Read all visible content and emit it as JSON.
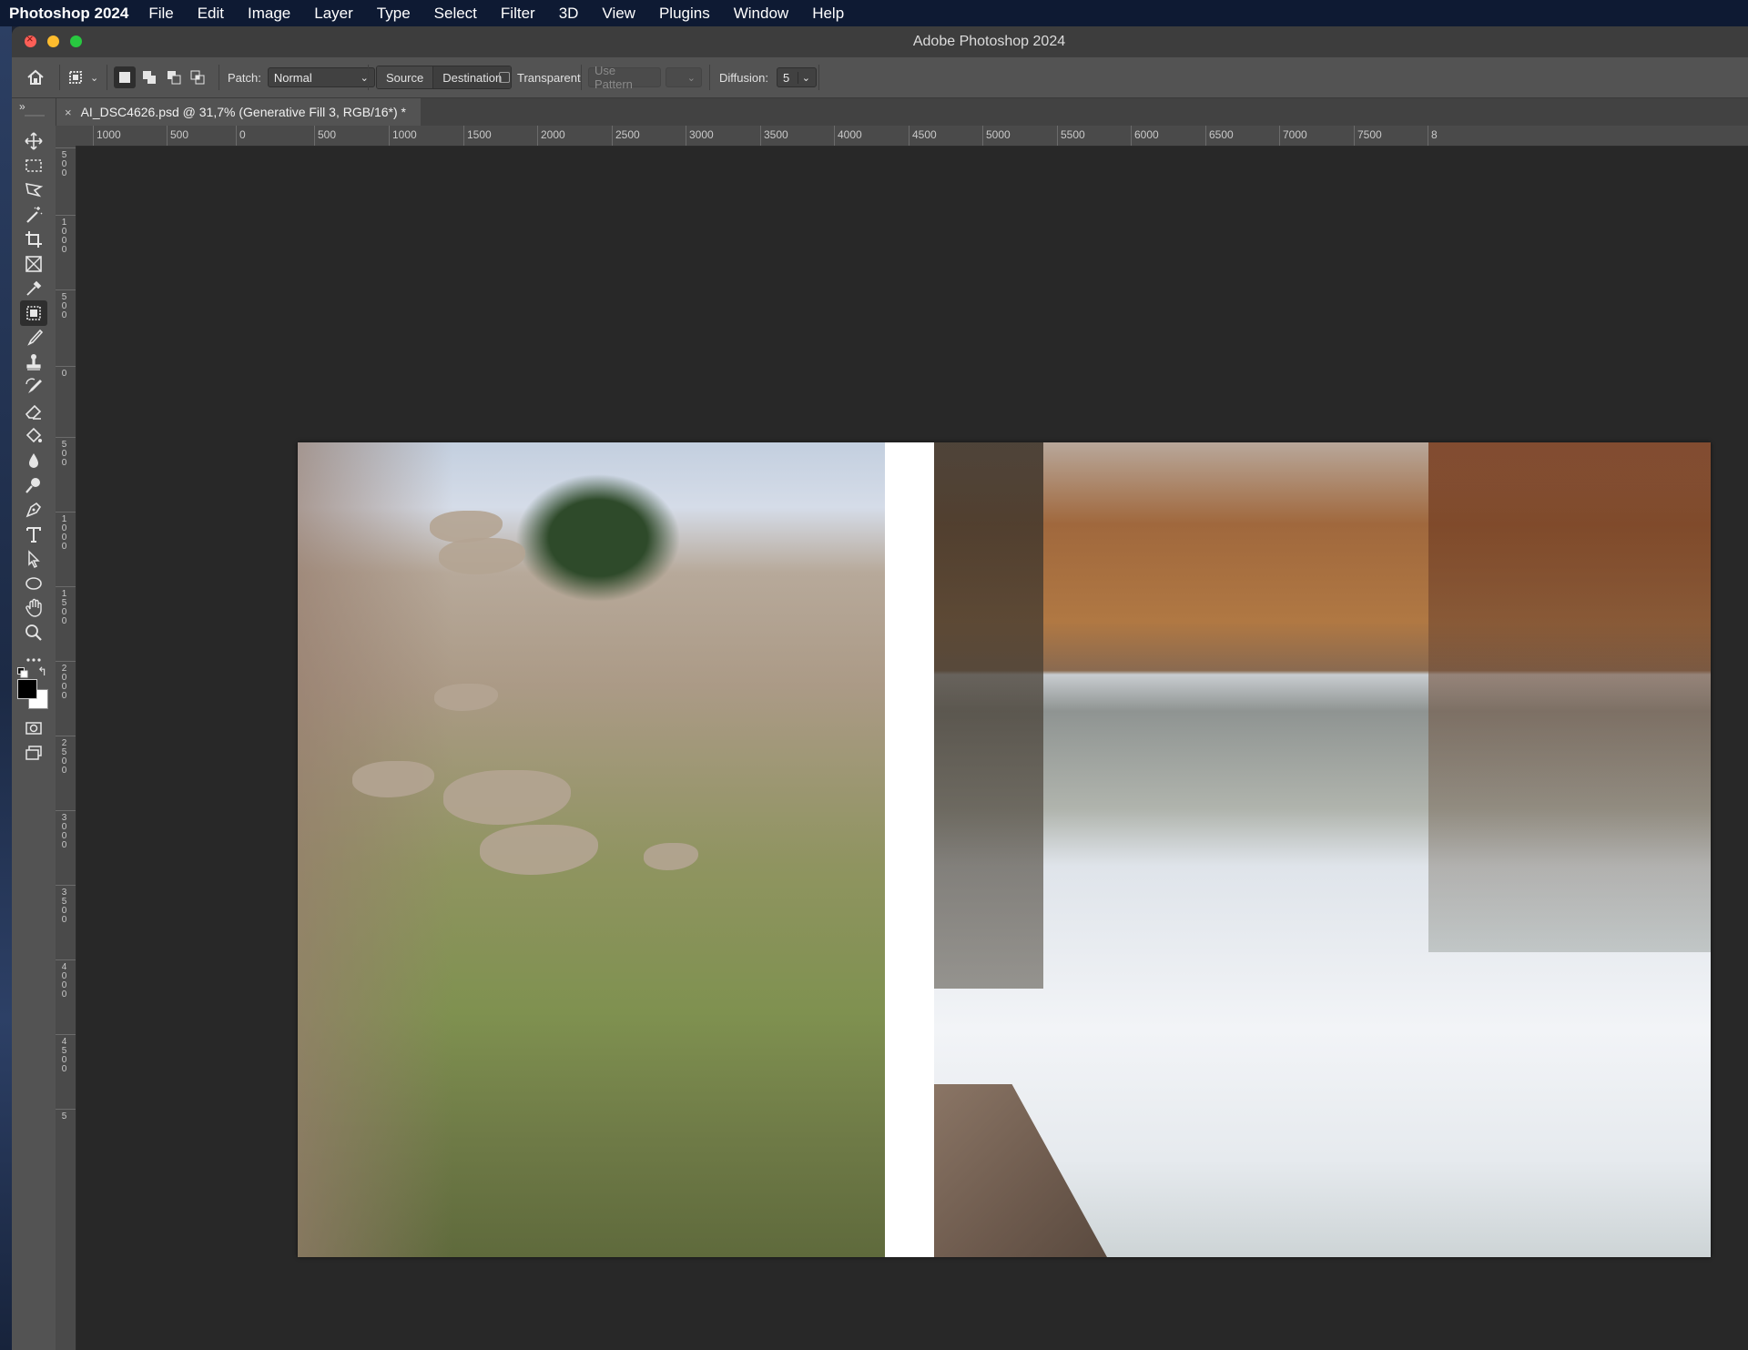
{
  "menubar": {
    "app_name": "Photoshop 2024",
    "items": [
      "File",
      "Edit",
      "Image",
      "Layer",
      "Type",
      "Select",
      "Filter",
      "3D",
      "View",
      "Plugins",
      "Window",
      "Help"
    ]
  },
  "window": {
    "title": "Adobe Photoshop 2024"
  },
  "options_bar": {
    "patch_label": "Patch:",
    "patch_value": "Normal",
    "source_label": "Source",
    "destination_label": "Destination",
    "transparent_label": "Transparent",
    "transparent_checked": false,
    "use_pattern_label": "Use Pattern",
    "diffusion_label": "Diffusion:",
    "diffusion_value": "5"
  },
  "document_tab": {
    "close_glyph": "×",
    "title": "AI_DSC4626.psd @ 31,7% (Generative Fill 3, RGB/16*) *"
  },
  "toolbar": {
    "expand_glyph": "»",
    "tools": [
      "move-tool",
      "marquee-tool",
      "lasso-tool",
      "magic-wand-tool",
      "crop-tool",
      "frame-tool",
      "eyedropper-tool",
      "patch-tool",
      "brush-tool",
      "clone-stamp-tool",
      "history-brush-tool",
      "eraser-tool",
      "paint-bucket-tool",
      "blur-tool",
      "dodge-tool",
      "pen-tool",
      "type-tool",
      "path-selection-tool",
      "ellipse-tool",
      "hand-tool",
      "zoom-tool",
      "more-tools",
      "colors",
      "quick-mask",
      "screen-mode"
    ],
    "active_tool": "patch-tool",
    "foreground_color": "#000000",
    "background_color": "#ffffff"
  },
  "ruler_top": [
    "1000",
    "500",
    "0",
    "500",
    "1000",
    "1500",
    "2000",
    "2500",
    "3000",
    "3500",
    "4000",
    "4500",
    "5000",
    "5500",
    "6000",
    "6500",
    "7000",
    "7500",
    "8"
  ],
  "ruler_left": [
    "500",
    "1000",
    "500",
    "0",
    "500",
    "1000",
    "1500",
    "2000",
    "2500",
    "3000",
    "3500",
    "4000",
    "4500",
    "5"
  ],
  "colors": {
    "menubar_bg": "#0e1a33",
    "panel_bg": "#535353",
    "canvas_bg": "#282828"
  }
}
